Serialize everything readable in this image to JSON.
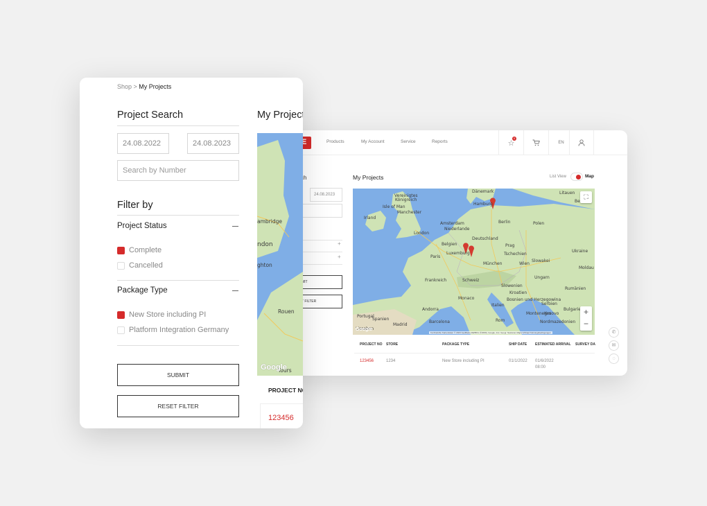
{
  "back": {
    "logo_text": "KE",
    "nav": [
      "Products",
      "My Account",
      "Service",
      "Reports"
    ],
    "cart_badge": "0",
    "lang": "EN",
    "sidebar": {
      "search_fragment": "ch",
      "date_to": "24.08.2023",
      "number_fragment": "ber",
      "submit_fragment": "MIT",
      "reset_fragment": "T FILTER"
    },
    "title": "My Projects",
    "view_list": "List View",
    "view_map": "Map",
    "map_attribution": "Kurzbefehle   Kartendaten © 2023 GeoBasis-DE/BKG (©2009), Google, Inst. Geogr. Nacional, Mapa GISrael   Nutzungsbedingungen",
    "table": {
      "headers": [
        "PROJECT NO",
        "STORE",
        "PACKAGE TYPE",
        "SHIP DATE",
        "ESTIMATED ARRIVAL",
        "SURVEY DA"
      ],
      "row": {
        "project_no": "123456",
        "store": "1234",
        "package_type": "New Store including PI",
        "ship_date": "01/1/2022",
        "arrival": "01/6/2022",
        "arrival_time": "08:00"
      }
    },
    "map_labels": {
      "danemark": "Dänemark",
      "vk": "Vereinigtes",
      "vk2": "Königreich",
      "isle": "Isle of Man",
      "irland": "Irland",
      "manchester": "Manchester",
      "hamburg": "Hamburg",
      "amsterdam": "Amsterdam",
      "niederlande": "Niederlande",
      "london": "London",
      "berlin": "Berlin",
      "polen": "Polen",
      "belgien": "Belgien",
      "deutschland": "Deutschland",
      "luxemburg": "Luxemburg",
      "prag": "Prag",
      "paris": "Paris",
      "tschechien": "Tschechien",
      "slowakei": "Slowakei",
      "muenchen": "München",
      "wien": "Wien",
      "frankreich": "Frankreich",
      "schweiz": "Schweiz",
      "ungarn": "Ungarn",
      "slowenien": "Slowenien",
      "kroatien": "Kroatien",
      "rumaenien": "Rumänien",
      "monaco": "Monaco",
      "andorra": "Andorra",
      "italien": "Italien",
      "serbien": "Serbien",
      "bosnien": "Bosnien und Herzegowina",
      "montenegro": "Montenegro",
      "kosovo": "Kosovo",
      "nordmazedonien": "Nordmazedonien",
      "litauen": "Litauen",
      "belarus": "Belarus",
      "ukraine": "Ukraine",
      "moldau": "Moldau",
      "bulgarien": "Bulgarien",
      "rom": "Rom",
      "barcelona": "Barcelona",
      "madrid": "Madrid",
      "portugal": "Portugal",
      "spanien": "Spanien",
      "lissabon": "Lissabon"
    }
  },
  "front": {
    "breadcrumb_parent": "Shop >",
    "breadcrumb_current": "My Projects",
    "search_title": "Project Search",
    "date_from": "24.08.2022",
    "date_to": "24.08.2023",
    "number_placeholder": "Search by Number",
    "filter_title": "Filter by",
    "status_group": "Project Status",
    "status_options": [
      "Complete",
      "Cancelled"
    ],
    "package_group": "Package Type",
    "package_options": [
      "New Store including PI",
      "Platform Integration Germany"
    ],
    "submit": "SUBMIT",
    "reset": "RESET FILTER",
    "projects_title": "My Projects",
    "table_header": "PROJECT NO",
    "first_project": "123456",
    "map_labels": {
      "cambridge": "ambridge",
      "london": "ndon",
      "brighton": "ghton",
      "rouen": "Rouen",
      "tours": "Tours"
    },
    "google": "Google"
  },
  "colors": {
    "accent": "#d52b2b",
    "water": "#7faee6",
    "land": "#cfe3b5"
  }
}
